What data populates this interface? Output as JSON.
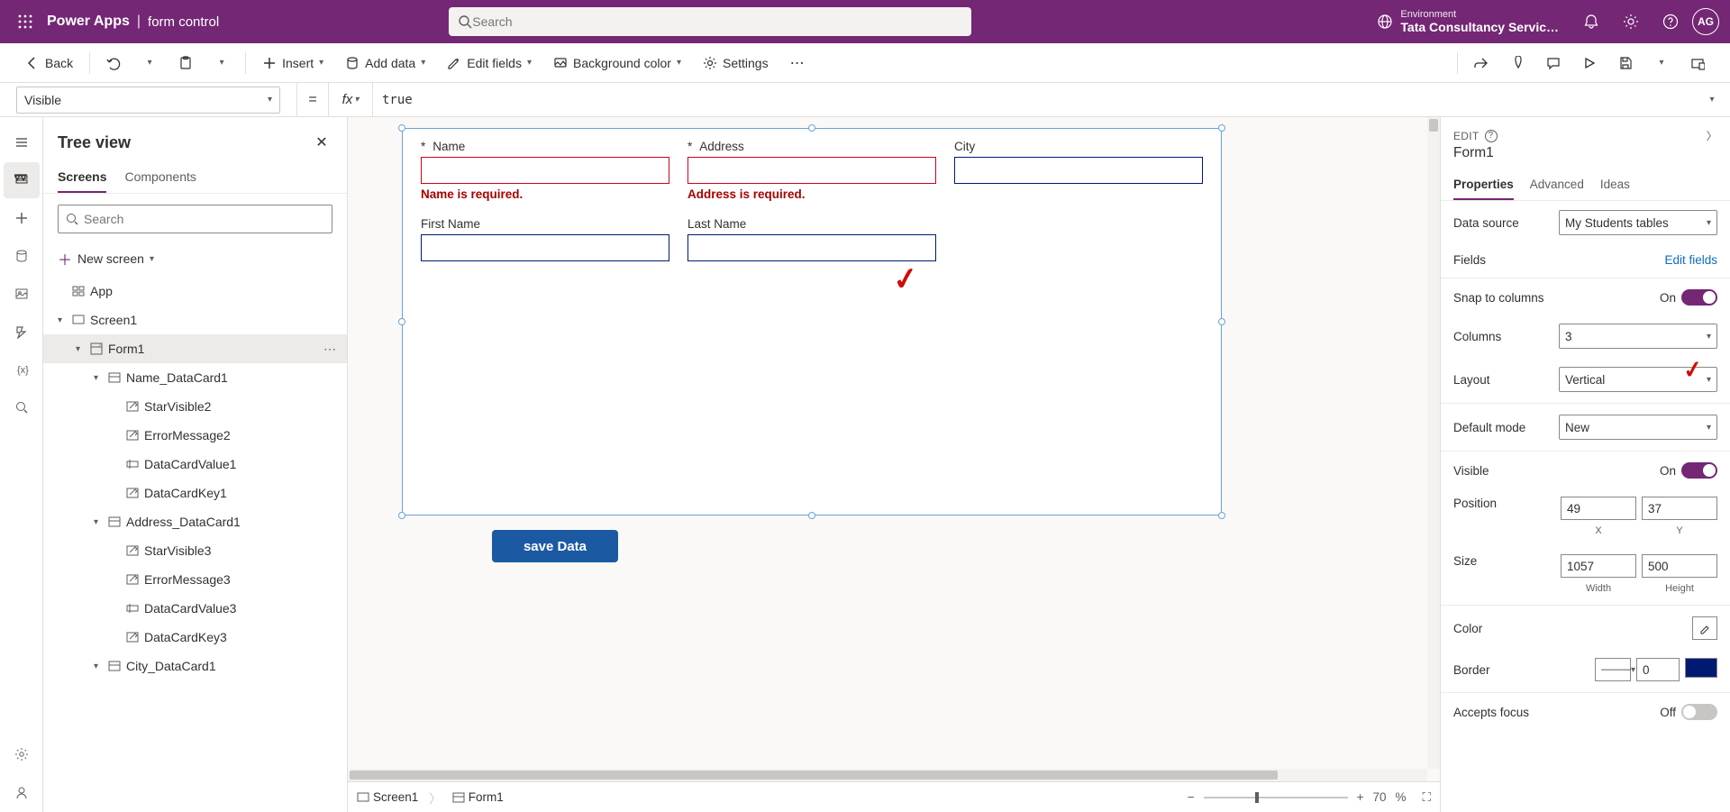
{
  "header": {
    "brand": "Power Apps",
    "sub": "form control",
    "search_placeholder": "Search",
    "env_label": "Environment",
    "env_name": "Tata Consultancy Servic…",
    "avatar": "AG"
  },
  "cmdbar": {
    "back": "Back",
    "insert": "Insert",
    "add_data": "Add data",
    "edit_fields": "Edit fields",
    "bg_color": "Background color",
    "settings": "Settings"
  },
  "formula": {
    "property": "Visible",
    "value": "true"
  },
  "tree": {
    "title": "Tree view",
    "tabs": {
      "screens": "Screens",
      "components": "Components"
    },
    "search_placeholder": "Search",
    "new_screen": "New screen",
    "items": [
      {
        "level": 0,
        "icon": "app",
        "label": "App",
        "chev": false
      },
      {
        "level": 0,
        "icon": "screen",
        "label": "Screen1",
        "chev": true
      },
      {
        "level": 1,
        "icon": "form",
        "label": "Form1",
        "chev": true,
        "sel": true,
        "more": true
      },
      {
        "level": 2,
        "icon": "card",
        "label": "Name_DataCard1",
        "chev": true
      },
      {
        "level": 3,
        "icon": "label",
        "label": "StarVisible2"
      },
      {
        "level": 3,
        "icon": "label",
        "label": "ErrorMessage2"
      },
      {
        "level": 3,
        "icon": "input",
        "label": "DataCardValue1"
      },
      {
        "level": 3,
        "icon": "label",
        "label": "DataCardKey1"
      },
      {
        "level": 2,
        "icon": "card",
        "label": "Address_DataCard1",
        "chev": true
      },
      {
        "level": 3,
        "icon": "label",
        "label": "StarVisible3"
      },
      {
        "level": 3,
        "icon": "label",
        "label": "ErrorMessage3"
      },
      {
        "level": 3,
        "icon": "input",
        "label": "DataCardValue3"
      },
      {
        "level": 3,
        "icon": "label",
        "label": "DataCardKey3"
      },
      {
        "level": 2,
        "icon": "card",
        "label": "City_DataCard1",
        "chev": true
      }
    ]
  },
  "canvas": {
    "fields": [
      {
        "label": "Name",
        "required": true,
        "error": "Name is required."
      },
      {
        "label": "Address",
        "required": true,
        "error": "Address is required."
      },
      {
        "label": "City",
        "required": false
      },
      {
        "label": "First Name",
        "required": false
      },
      {
        "label": "Last Name",
        "required": false
      }
    ],
    "save_btn": "save Data"
  },
  "breadcrumb": {
    "screen": "Screen1",
    "form": "Form1",
    "zoom": "70",
    "zoom_unit": "%"
  },
  "props": {
    "edit": "EDIT",
    "title": "Form1",
    "tabs": {
      "properties": "Properties",
      "advanced": "Advanced",
      "ideas": "Ideas"
    },
    "data_source": {
      "label": "Data source",
      "value": "My Students tables"
    },
    "fields": {
      "label": "Fields",
      "link": "Edit fields"
    },
    "snap": {
      "label": "Snap to columns",
      "state": "On"
    },
    "columns": {
      "label": "Columns",
      "value": "3"
    },
    "layout": {
      "label": "Layout",
      "value": "Vertical"
    },
    "default_mode": {
      "label": "Default mode",
      "value": "New"
    },
    "visible": {
      "label": "Visible",
      "state": "On"
    },
    "position": {
      "label": "Position",
      "x": "49",
      "y": "37",
      "xl": "X",
      "yl": "Y"
    },
    "size": {
      "label": "Size",
      "w": "1057",
      "h": "500",
      "wl": "Width",
      "hl": "Height"
    },
    "color": {
      "label": "Color"
    },
    "border": {
      "label": "Border",
      "style": "———",
      "width": "0",
      "color": "#001a73"
    },
    "accepts_focus": {
      "label": "Accepts focus",
      "state": "Off"
    }
  }
}
